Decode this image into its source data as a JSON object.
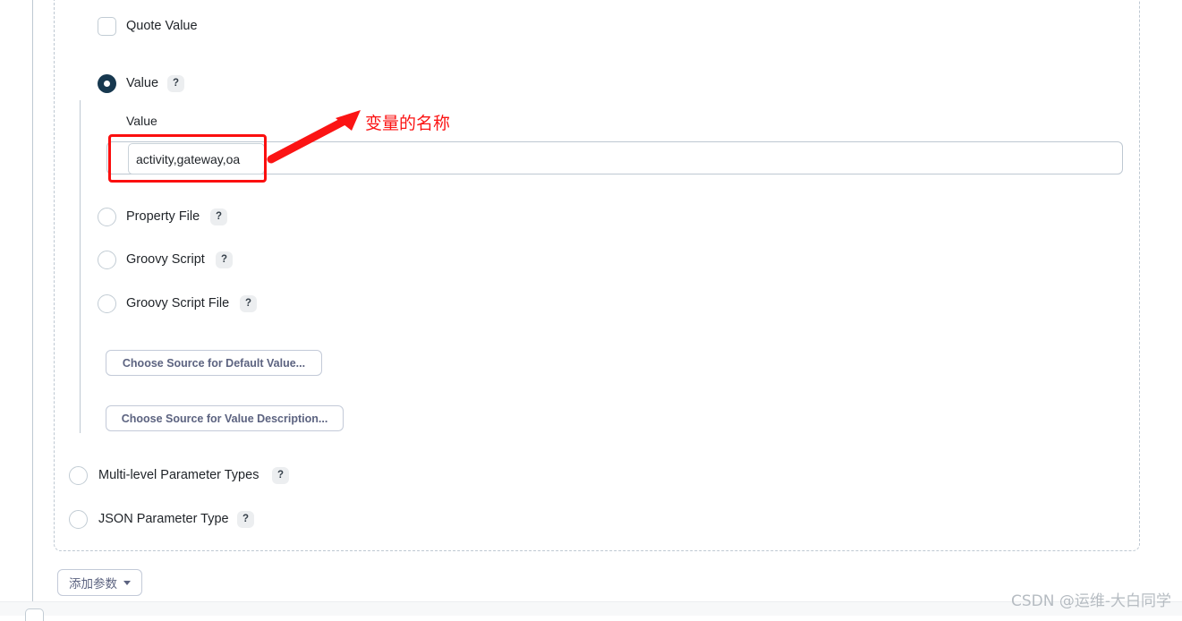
{
  "options": {
    "quote_value": {
      "label": "Quote Value",
      "type": "checkbox",
      "checked": false
    },
    "value": {
      "label": "Value",
      "type": "radio",
      "checked": true,
      "help": "?"
    },
    "property_file": {
      "label": "Property File",
      "type": "radio",
      "checked": false,
      "help": "?"
    },
    "groovy_script": {
      "label": "Groovy Script",
      "type": "radio",
      "checked": false,
      "help": "?"
    },
    "groovy_script_file": {
      "label": "Groovy Script File",
      "type": "radio",
      "checked": false,
      "help": "?"
    },
    "multi_level": {
      "label": "Multi-level Parameter Types",
      "type": "radio",
      "checked": false,
      "help": "?"
    },
    "json_param": {
      "label": "JSON Parameter Type",
      "type": "radio",
      "checked": false,
      "help": "?"
    }
  },
  "value_field": {
    "label": "Value",
    "input_value": "activity,gateway,oa",
    "input_placeholder": ""
  },
  "buttons": {
    "choose_default": "Choose Source for Default Value...",
    "choose_description": "Choose Source for Value Description...",
    "add_parameter": "添加参数"
  },
  "annotation": {
    "text": "变量的名称",
    "color": "#fb1414"
  },
  "watermark": "CSDN @运维-大白同学",
  "colors": {
    "selected_radio": "#17384f",
    "border": "#bec8d2",
    "button_text": "#5c6380",
    "annotation_red": "#fb0f0f"
  }
}
